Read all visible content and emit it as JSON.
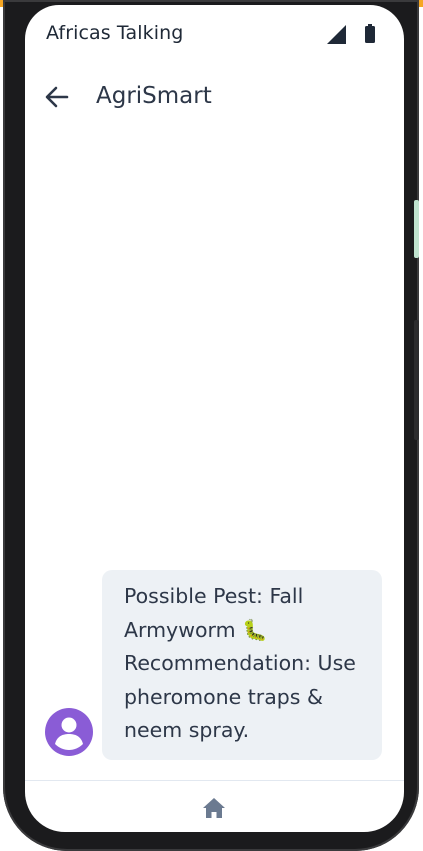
{
  "status_bar": {
    "carrier": "Africas Talking",
    "signal_icon": "cellular-signal-icon",
    "battery_icon": "battery-icon"
  },
  "app_bar": {
    "back_icon": "arrow-back-icon",
    "title": "AgriSmart"
  },
  "messages": [
    {
      "sender_icon": "account-circle-icon",
      "lines": [
        "Possible Pest: Fall",
        "Armyworm 🐛",
        "Recommendation: Use",
        "pheromone traps &",
        "neem spray."
      ]
    }
  ],
  "bottom_nav": {
    "home_icon": "home-icon"
  },
  "colors": {
    "accent_strip": "#f6a623",
    "avatar": "#8a5cd6",
    "bubble_bg": "#edf1f5",
    "text": "#2d3748"
  }
}
